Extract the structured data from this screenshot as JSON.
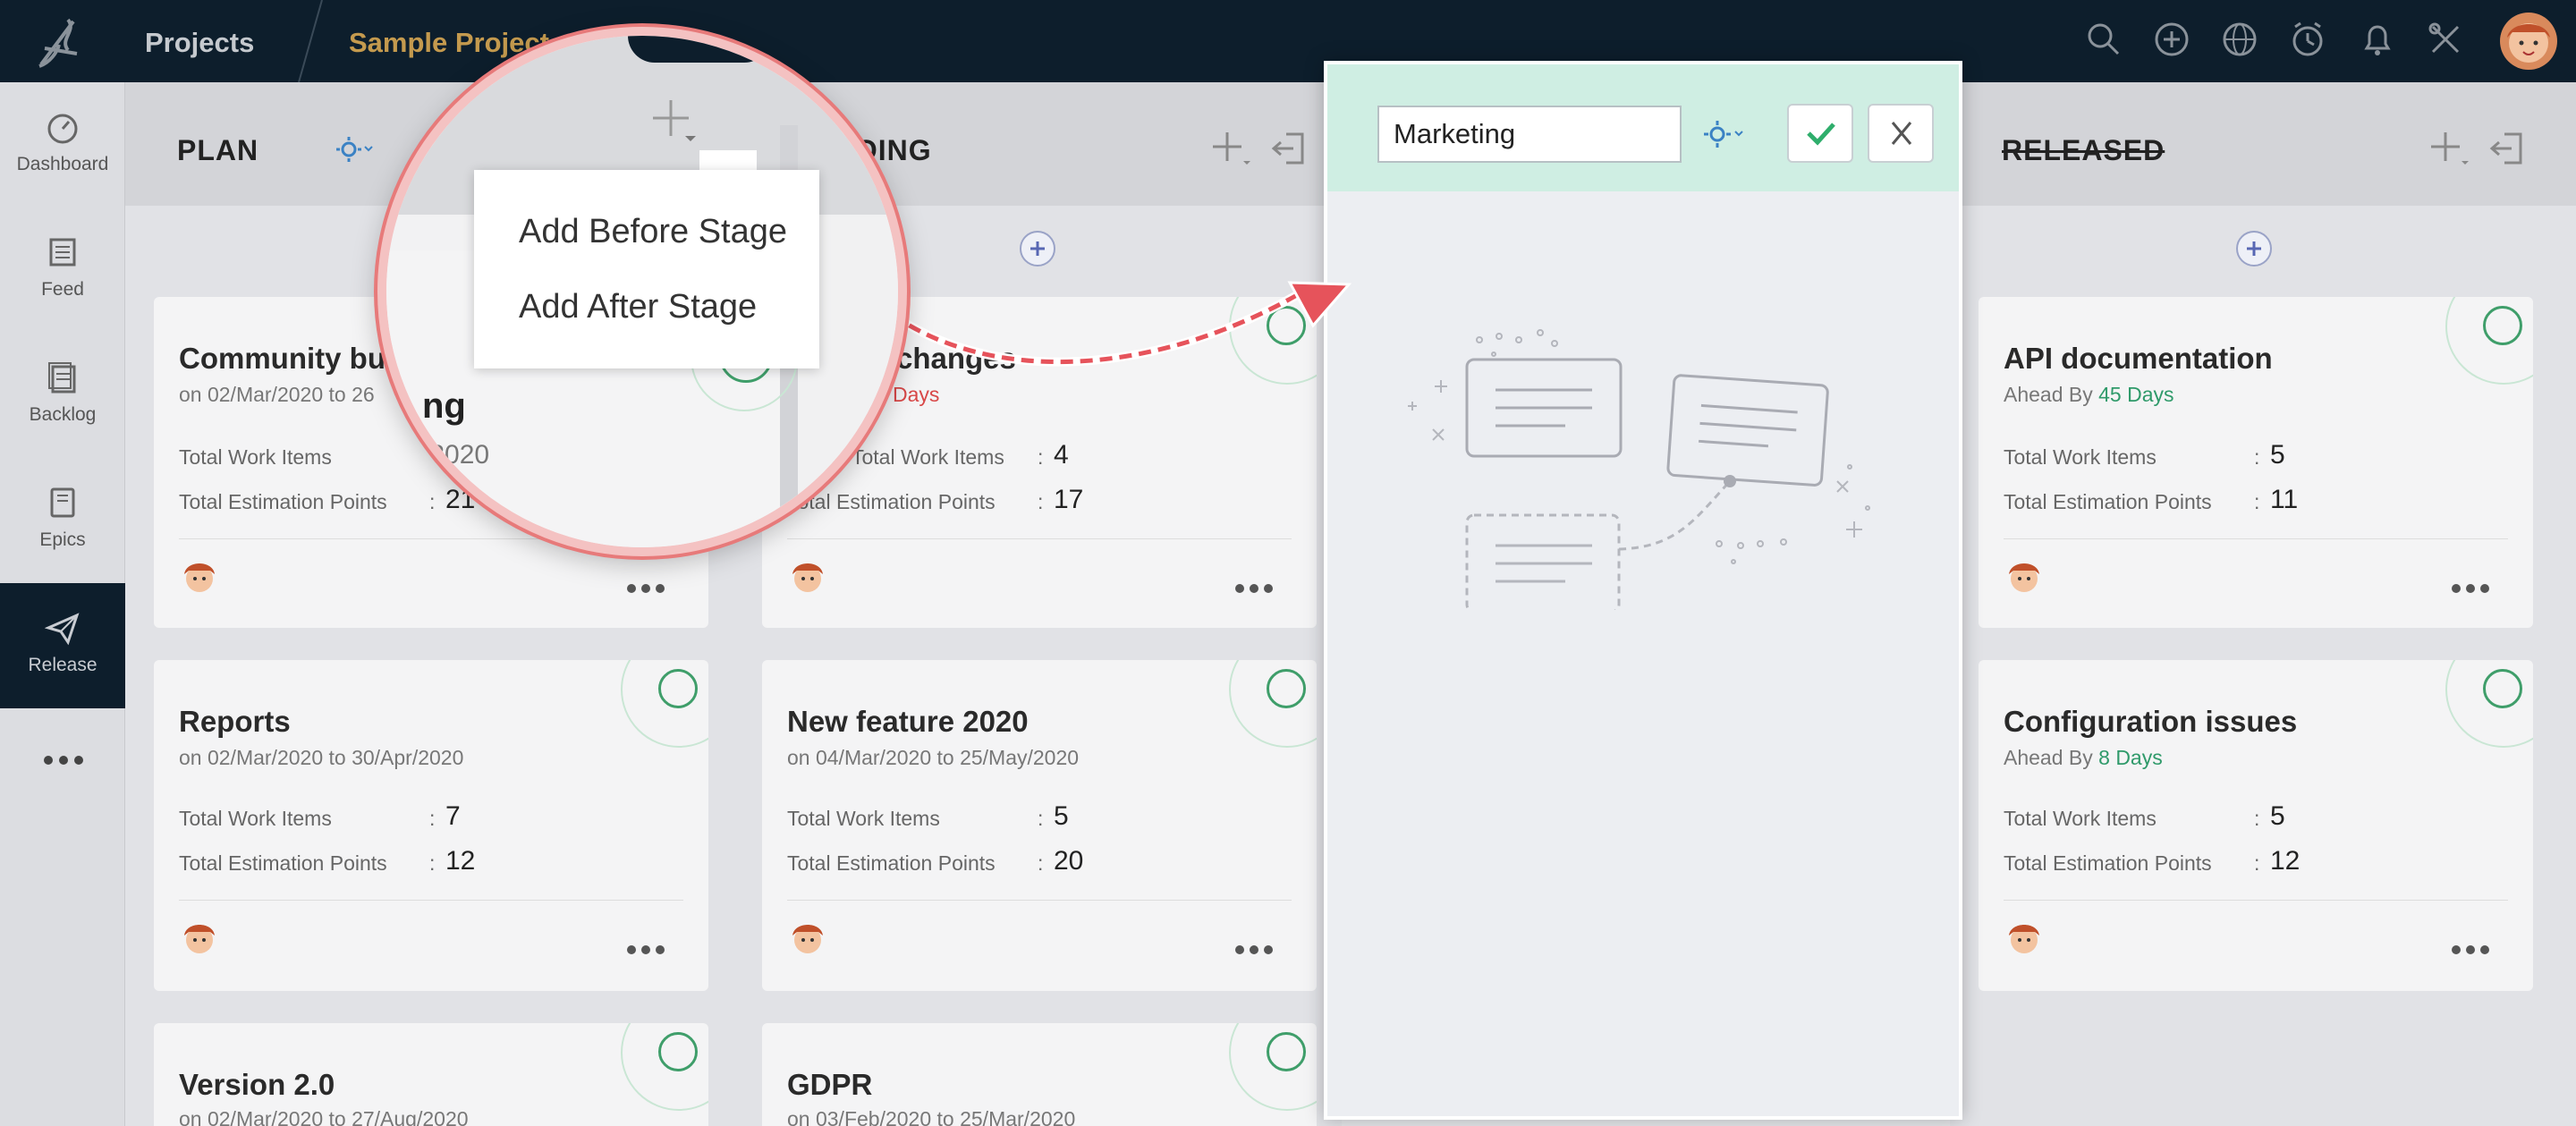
{
  "topbar": {
    "projects_label": "Projects",
    "project_name": "Sample Project",
    "icons": [
      "search-icon",
      "plus-circle-icon",
      "globe-icon",
      "timer-icon",
      "bell-icon",
      "tools-icon"
    ],
    "colors": {
      "background": "#0d1e2c",
      "project_name": "#c49a4e"
    }
  },
  "sidebar": {
    "items": [
      {
        "label": "Dashboard",
        "icon": "dashboard-icon"
      },
      {
        "label": "Feed",
        "icon": "feed-icon"
      },
      {
        "label": "Backlog",
        "icon": "backlog-icon"
      },
      {
        "label": "Epics",
        "icon": "epics-icon"
      },
      {
        "label": "Release",
        "icon": "release-icon",
        "active": true
      }
    ],
    "more_icon": "more-dots-icon"
  },
  "stages": {
    "plan": {
      "title": "PLAN"
    },
    "ongoing": {
      "title": "GOING"
    },
    "released": {
      "title": "RELEASED"
    }
  },
  "labels": {
    "total_work_items": "Total Work Items",
    "total_estimation_points": "Total Estimation Points",
    "colon": ":"
  },
  "cards": {
    "c1": {
      "title": "Community bu",
      "sub": "on 02/Mar/2020 to 26",
      "work": "",
      "points": "21"
    },
    "c2": {
      "title": "Reports",
      "sub": "on 02/Mar/2020 to 30/Apr/2020",
      "work": "7",
      "points": "12"
    },
    "c3": {
      "title": "Version 2.0",
      "sub": "on 02/Mar/2020 to 27/Aug/2020"
    },
    "c4": {
      "title": "changes",
      "late_text": "Days",
      "work": "4",
      "points": "17"
    },
    "c5": {
      "title": "New feature 2020",
      "sub": "on 04/Mar/2020 to 25/May/2020",
      "work": "5",
      "points": "20"
    },
    "c6": {
      "title": "GDPR",
      "sub": "on 03/Feb/2020 to 25/Mar/2020"
    },
    "c7": {
      "title": "API documentation",
      "sub_prefix": "Ahead By",
      "sub_days": "45 Days",
      "work": "5",
      "points": "11"
    },
    "c8": {
      "title": "Configuration issues",
      "sub_prefix": "Ahead By",
      "sub_days": "8 Days",
      "work": "5",
      "points": "12"
    }
  },
  "magnifier": {
    "menu": {
      "add_before": "Add Before Stage",
      "add_after": "Add After Stage"
    },
    "card_title_fragment": "ng",
    "card_sub_fragment": "/2020"
  },
  "panel": {
    "input_value": "Marketing",
    "confirm_icon": "check-icon",
    "cancel_icon": "close-icon",
    "colors": {
      "header": "#cfeee3",
      "confirm": "#2fae6c"
    }
  }
}
